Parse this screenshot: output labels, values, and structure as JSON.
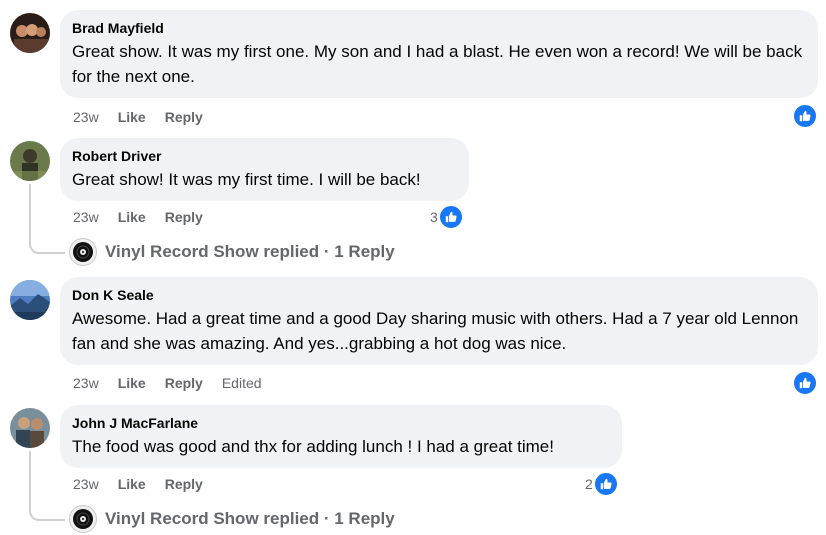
{
  "comments": [
    {
      "author": "Brad Mayfield",
      "text": "Great show. It was my first one. My son and I had a blast. He even won a record! We will be back for the next one.",
      "time": "23w",
      "like_label": "Like",
      "reply_label": "Reply",
      "reaction_count": "",
      "reaction_icon": "like-icon"
    },
    {
      "author": "Robert Driver",
      "text": "Great show! It was my first time. I will be back!",
      "time": "23w",
      "like_label": "Like",
      "reply_label": "Reply",
      "reaction_count": "3",
      "reaction_icon": "like-icon",
      "replied_text": "Vinyl Record Show replied · 1 Reply"
    },
    {
      "author": "Don K Seale",
      "text": "Awesome. Had a great time and a good Day sharing music with others. Had a 7 year old Lennon fan and she was amazing. And yes...grabbing a hot dog was nice.",
      "time": "23w",
      "like_label": "Like",
      "reply_label": "Reply",
      "edited_label": "Edited",
      "reaction_count": "",
      "reaction_icon": "like-icon"
    },
    {
      "author": "John J MacFarlane",
      "text": "The food was good and thx for adding lunch ! I had a great time!",
      "time": "23w",
      "like_label": "Like",
      "reply_label": "Reply",
      "reaction_count": "2",
      "reaction_icon": "like-icon",
      "replied_text": "Vinyl Record Show replied · 1 Reply"
    }
  ],
  "colors": {
    "bubble": "#f0f2f5",
    "meta_text": "#65676b",
    "like_blue": "#1877f2",
    "thread_line": "#ced0d4"
  }
}
